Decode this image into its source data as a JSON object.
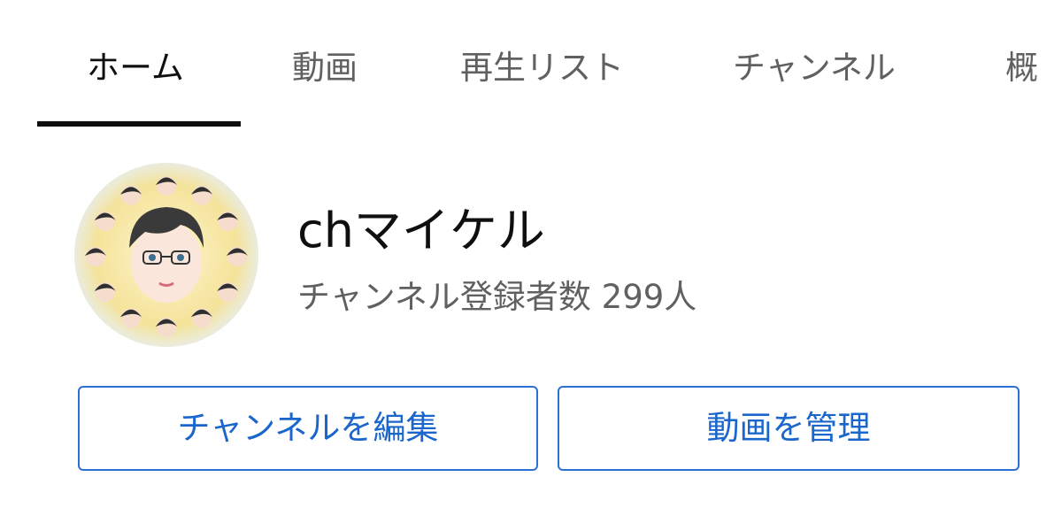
{
  "tabs": [
    {
      "label": "ホーム",
      "active": true
    },
    {
      "label": "動画",
      "active": false
    },
    {
      "label": "再生リスト",
      "active": false
    },
    {
      "label": "チャンネル",
      "active": false
    },
    {
      "label": "概",
      "active": false
    }
  ],
  "channel": {
    "name": "chマイケル",
    "subscribers": "チャンネル登録者数 299人",
    "avatar_icon": "channel-avatar"
  },
  "actions": {
    "edit_channel_label": "チャンネルを編集",
    "manage_videos_label": "動画を管理"
  },
  "colors": {
    "accent": "#1a66cc",
    "button_border": "#2c6fd6",
    "text_primary": "#0f0f0f",
    "text_secondary": "#606060"
  }
}
